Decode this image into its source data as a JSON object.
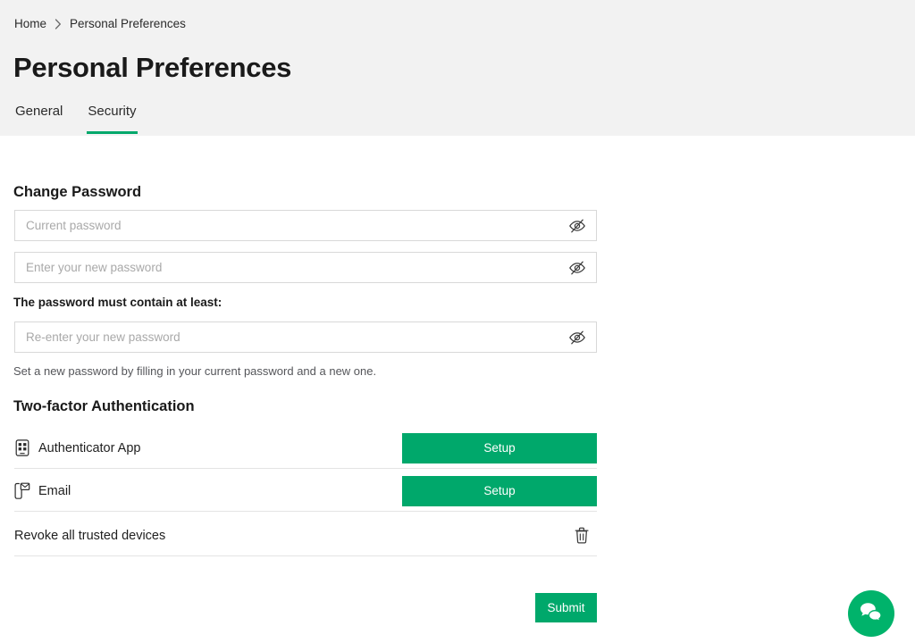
{
  "breadcrumb": {
    "home_label": "Home",
    "separator_icon": "chevron-right-icon",
    "current_label": "Personal Preferences"
  },
  "page": {
    "title": "Personal Preferences"
  },
  "tabs": [
    {
      "label": "General",
      "active": false
    },
    {
      "label": "Security",
      "active": true
    }
  ],
  "change_password": {
    "section_title": "Change Password",
    "current_password": {
      "placeholder": "Current password",
      "value": "",
      "toggle_icon": "eye-off-icon"
    },
    "new_password": {
      "placeholder": "Enter your new password",
      "value": "",
      "toggle_icon": "eye-off-icon"
    },
    "requirement_label": "The password must contain at least:",
    "confirm_password": {
      "placeholder": "Re-enter your new password",
      "value": "",
      "toggle_icon": "eye-off-icon"
    },
    "helper_text": "Set a new password by filling in your current password and a new one."
  },
  "two_factor": {
    "section_title": "Two-factor Authentication",
    "methods": [
      {
        "icon": "authenticator-app-icon",
        "label": "Authenticator App",
        "action_label": "Setup"
      },
      {
        "icon": "email-device-icon",
        "label": "Email",
        "action_label": "Setup"
      }
    ],
    "revoke": {
      "label": "Revoke all trusted devices",
      "icon": "trash-icon"
    }
  },
  "footer": {
    "submit_label": "Submit"
  },
  "chat_widget": {
    "icon": "chat-bubbles-icon"
  },
  "colors": {
    "accent_green": "#00a86b",
    "button_green": "#00a86b",
    "fab_green": "#00b36b",
    "header_background": "#f2f2f2",
    "page_background": "#ffffff",
    "text_primary": "#1a1a1a",
    "text_muted": "#55565a",
    "placeholder": "#a9a9a9",
    "field_border": "#d8d8d8",
    "divider": "#e4e4e4"
  }
}
